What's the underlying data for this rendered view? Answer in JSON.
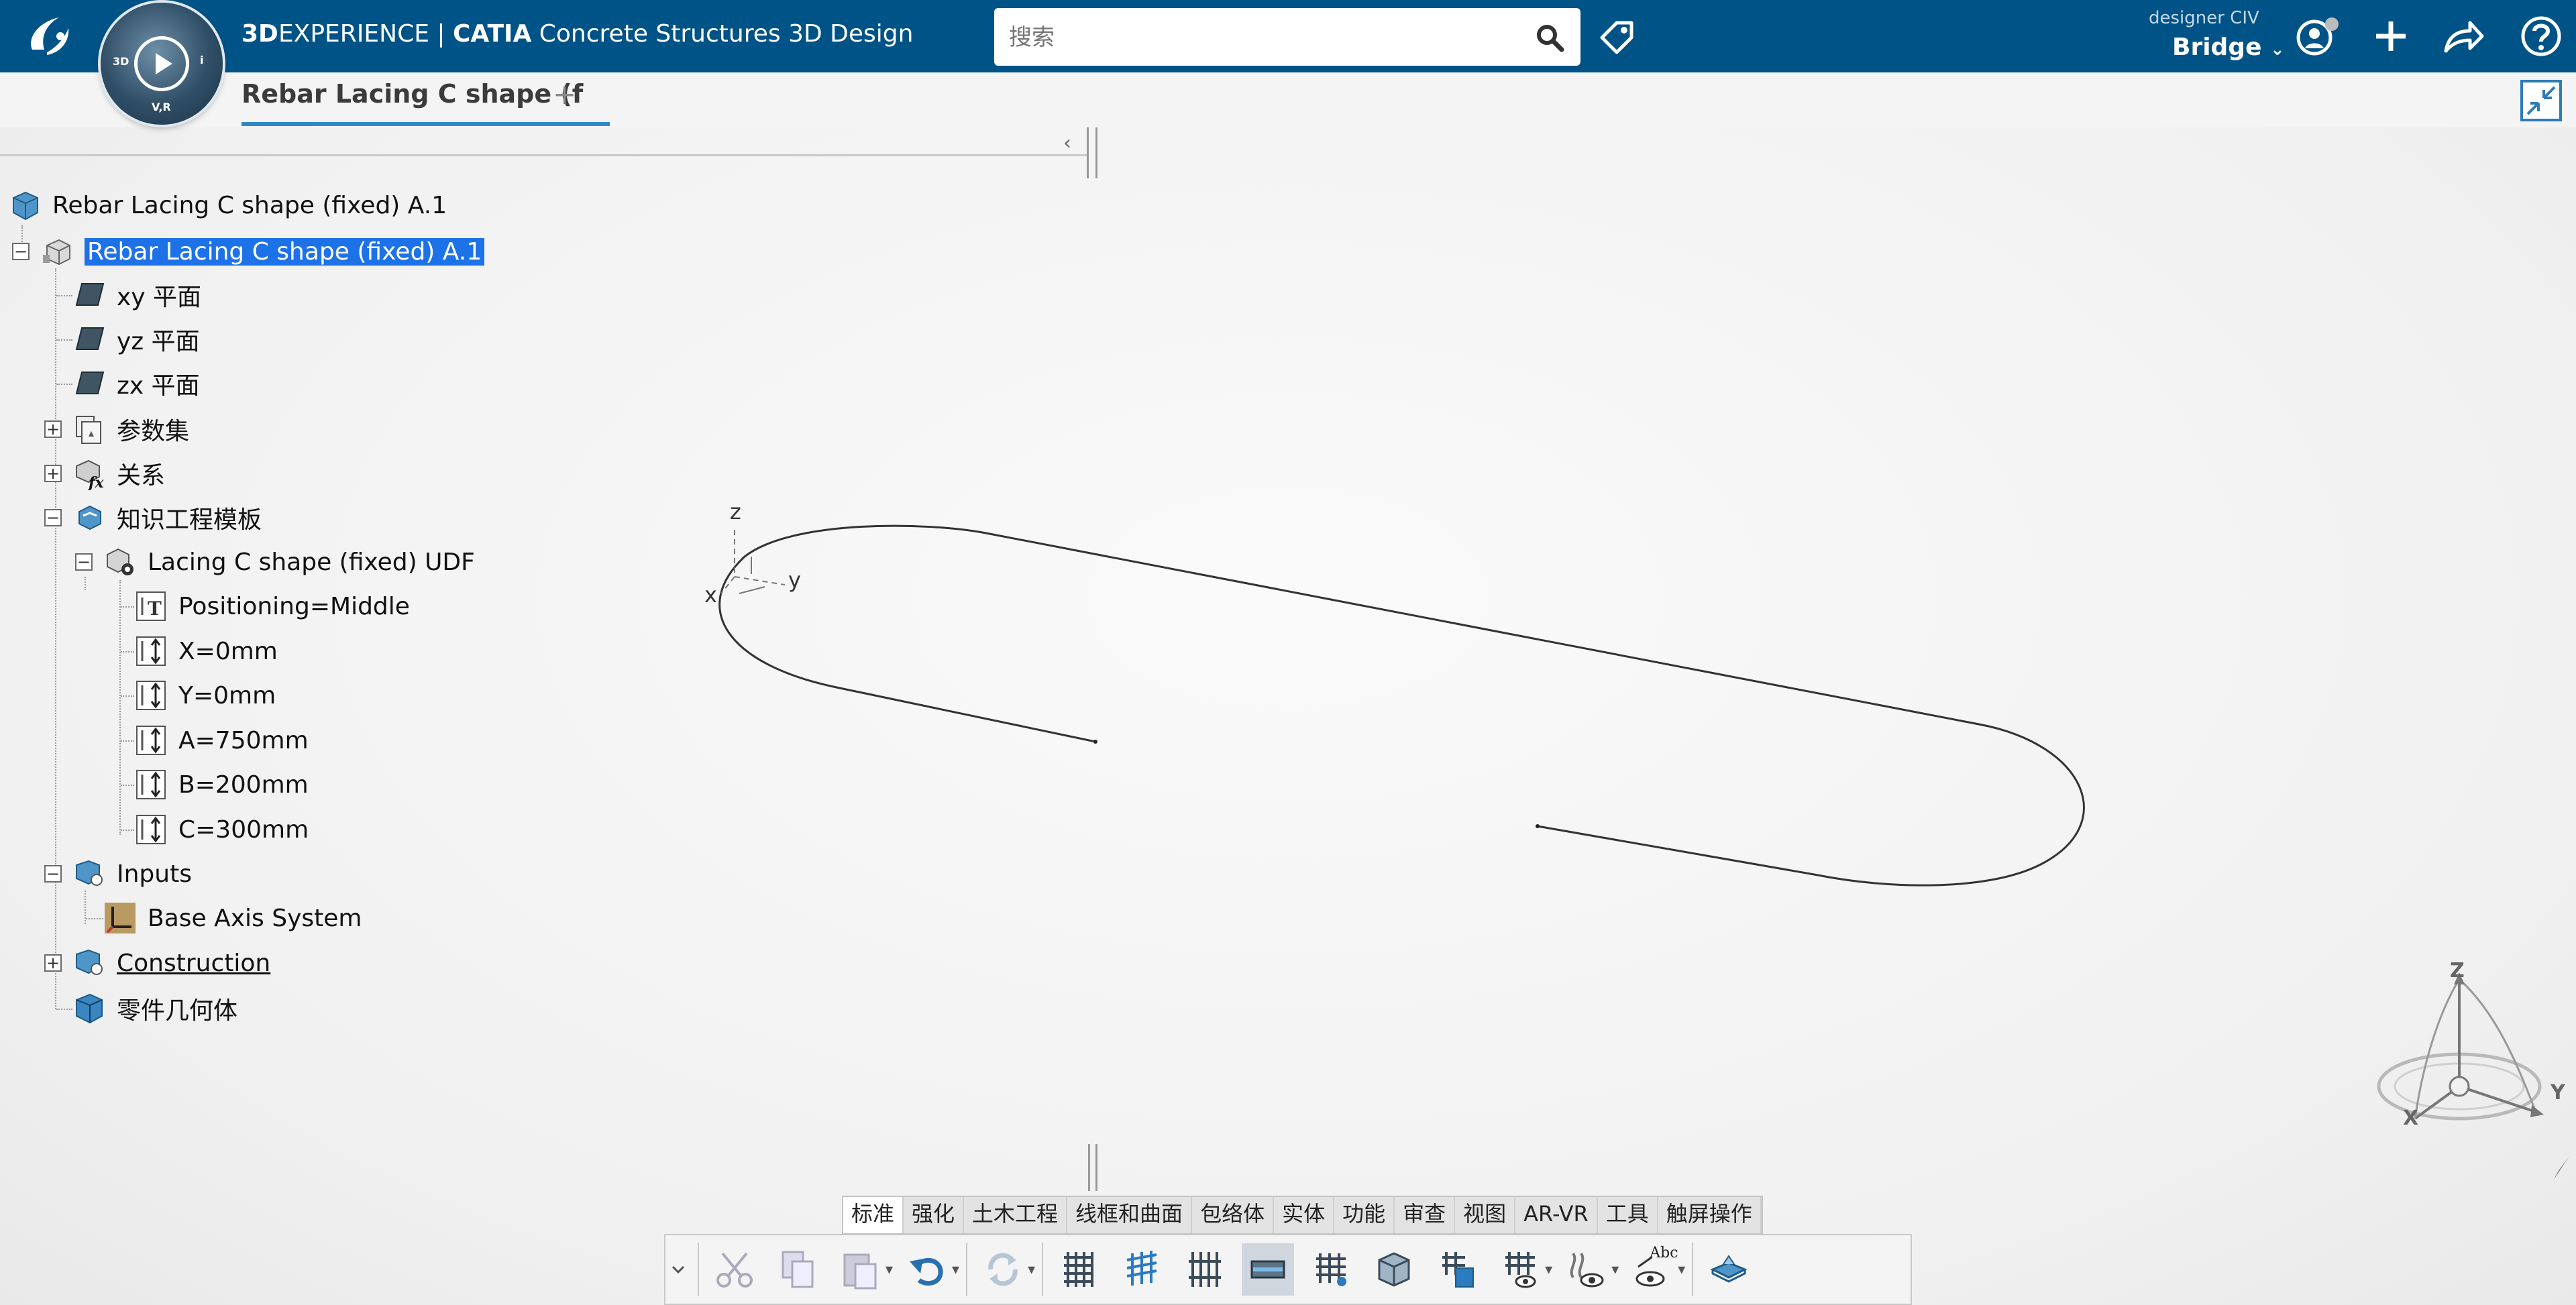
{
  "app": {
    "brand_prefix": "3D",
    "brand_mid": "EXPERIENCE | ",
    "brand_product": "CATIA",
    "brand_app": " Concrete Structures 3D Design",
    "compass_labels": [
      "3D",
      "V,R",
      "i"
    ]
  },
  "search": {
    "placeholder": "搜索"
  },
  "user": {
    "role": "designer CIV",
    "collab_space": "Bridge"
  },
  "tabs": {
    "active_label": "Rebar Lacing C shape (f",
    "add_label": "+"
  },
  "tree": {
    "root": "Rebar Lacing C shape (fixed) A.1",
    "items": [
      "Rebar Lacing C shape (fixed) A.1",
      "xy 平面",
      "yz 平面",
      "zx 平面",
      "参数集",
      "关系",
      "知识工程模板",
      "Lacing C shape (fixed) UDF",
      "Positioning=Middle",
      "X=0mm",
      "Y=0mm",
      "A=750mm",
      "B=200mm",
      "C=300mm",
      "Inputs",
      "Base Axis System",
      "Construction",
      "零件几何体"
    ]
  },
  "axis_labels": {
    "z": "z",
    "x": "x",
    "y": "y"
  },
  "compass3d_labels": {
    "z": "Z",
    "x": "X",
    "y": "Y"
  },
  "action_bar": {
    "categories": [
      "标准",
      "强化",
      "土木工程",
      "线框和曲面",
      "包络体",
      "实体",
      "功能",
      "审查",
      "视图",
      "AR-VR",
      "工具",
      "触屏操作"
    ],
    "active_category": "标准",
    "tool_icon_label": "Abc"
  },
  "colors": {
    "topbar": "#005386",
    "selection": "#1e72e8",
    "tab_underline": "#2e88c8"
  }
}
